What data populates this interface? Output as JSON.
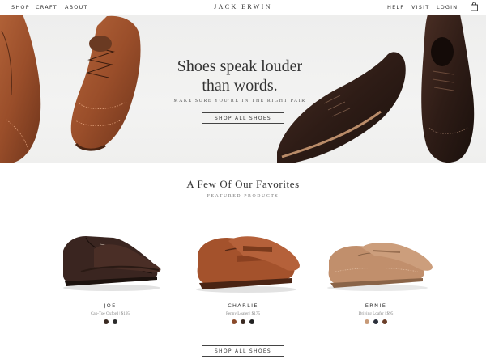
{
  "nav": {
    "left": [
      "SHOP",
      "CRAFT",
      "ABOUT"
    ],
    "brand": "JACK ERWIN",
    "right": [
      "HELP",
      "VISIT",
      "LOGIN"
    ],
    "cart_icon": "bag-icon"
  },
  "hero": {
    "title_line1": "Shoes speak louder",
    "title_line2": "than words.",
    "subtitle": "MAKE SURE YOU'RE IN THE RIGHT PAIR",
    "button": "SHOP ALL SHOES"
  },
  "featured": {
    "title": "A Few Of Our Favorites",
    "subtitle": "FEATURED PRODUCTS",
    "products": [
      {
        "name": "JOE",
        "desc": "Cap-Toe Oxford | $195",
        "swatches": [
          "#3a2a22",
          "#2b2b2b"
        ]
      },
      {
        "name": "CHARLIE",
        "desc": "Penny Loafer | $175",
        "swatches": [
          "#8a4a2a",
          "#3a2a22",
          "#222222"
        ]
      },
      {
        "name": "ERNIE",
        "desc": "Driving Loafer | $95",
        "swatches": [
          "#c79a78",
          "#2b2f3a",
          "#6b3f2a"
        ]
      }
    ],
    "button": "SHOP ALL SHOES"
  }
}
